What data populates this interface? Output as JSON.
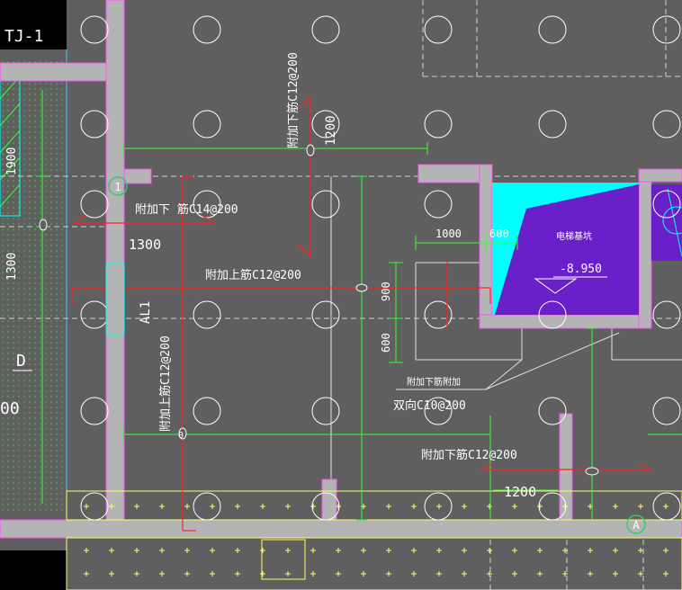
{
  "colors": {
    "background": "#5f5f5f",
    "wall": "#b4b4b4",
    "wall_outline": "#ff4cff",
    "pile": "#ffffff",
    "dimension": "#33ff33",
    "rebar": "#ff2020",
    "hatch": "#ffff66",
    "cyan": "#00ffff",
    "pit": "#6a20c8",
    "axis_bubble": "#33cc66",
    "text": "#ffffff"
  },
  "labels": {
    "tj": "TJ-1",
    "d": "D",
    "partial_left": "00",
    "al": "AL1",
    "axis_1": "1",
    "axis_a": "A"
  },
  "dimensions": {
    "d1900": "1900",
    "d1300_left": "1300",
    "d1300": "1300",
    "d1200_top": "1200",
    "d1000": "1000",
    "d600_h": "600",
    "d900": "900",
    "d600_v": "600",
    "d1200_bottom": "1200",
    "zero": "0"
  },
  "rebar_notes": {
    "top_vertical": "附加下筋C12@200",
    "c14": "附加下  筋C14@200",
    "c12_upper": "附加上筋C12@200",
    "left_vertical": "附加上筋C12@200",
    "pit_note_line1": "附加下筋附加",
    "pit_note_line2": "双向C10@200",
    "c12_lower": "附加下筋C12@200"
  },
  "pit": {
    "label": "电梯基坑",
    "elevation": "-8.950"
  }
}
